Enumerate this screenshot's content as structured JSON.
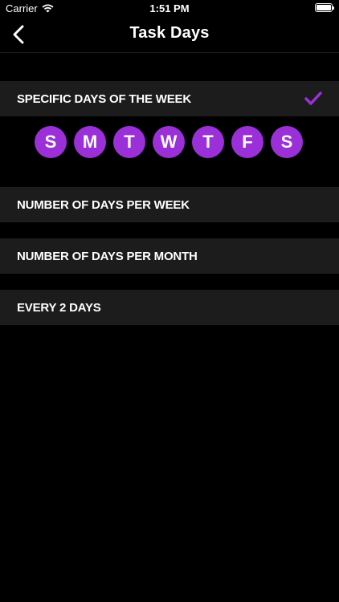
{
  "status_bar": {
    "carrier": "Carrier",
    "time": "1:51 PM",
    "wifi_icon": "wifi-icon",
    "battery_icon": "battery-icon"
  },
  "nav": {
    "title": "Task Days",
    "back_icon": "chevron-left-icon"
  },
  "colors": {
    "accent": "#9b30d9",
    "row_background": "#1c1c1c",
    "background": "#000000"
  },
  "options": [
    {
      "label": "SPECIFIC DAYS OF THE WEEK",
      "selected": true
    },
    {
      "label": "NUMBER OF DAYS PER WEEK",
      "selected": false
    },
    {
      "label": "NUMBER OF DAYS PER MONTH",
      "selected": false
    },
    {
      "label": "EVERY 2 DAYS",
      "selected": false
    }
  ],
  "days": [
    {
      "letter": "S",
      "selected": true
    },
    {
      "letter": "M",
      "selected": true
    },
    {
      "letter": "T",
      "selected": true
    },
    {
      "letter": "W",
      "selected": true
    },
    {
      "letter": "T",
      "selected": true
    },
    {
      "letter": "F",
      "selected": true
    },
    {
      "letter": "S",
      "selected": true
    }
  ]
}
